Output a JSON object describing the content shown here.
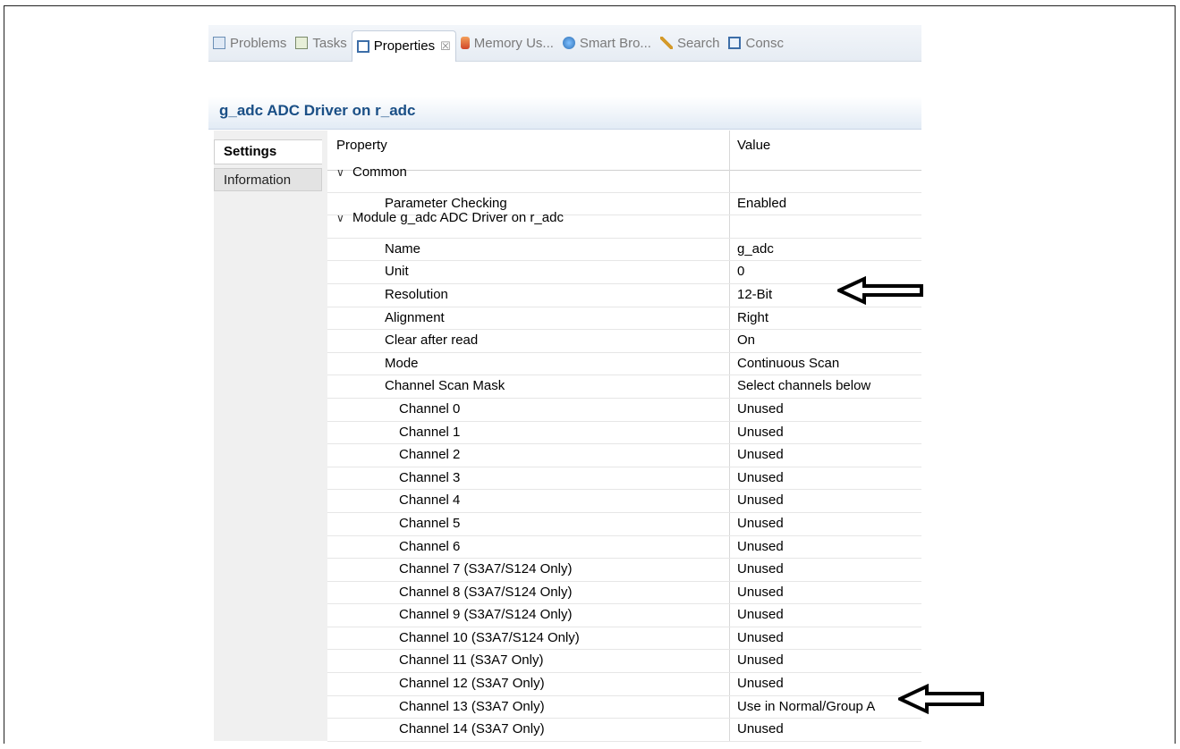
{
  "tabs": [
    {
      "label": "Problems",
      "icon": "problems-icon",
      "active": false
    },
    {
      "label": "Tasks",
      "icon": "tasks-icon",
      "active": false
    },
    {
      "label": "Properties",
      "icon": "properties-icon",
      "active": true
    },
    {
      "label": "Memory Us...",
      "icon": "memory-usage-icon",
      "active": false
    },
    {
      "label": "Smart Bro...",
      "icon": "smart-browser-icon",
      "active": false
    },
    {
      "label": "Search",
      "icon": "search-icon",
      "active": false
    },
    {
      "label": "Consc",
      "icon": "console-icon",
      "active": false
    }
  ],
  "title": "g_adc ADC Driver on r_adc",
  "side_tabs": {
    "settings": "Settings",
    "information": "Information"
  },
  "table": {
    "header_property": "Property",
    "header_value": "Value",
    "rows": [
      {
        "property": "Common",
        "value": "",
        "level": 0,
        "group": true
      },
      {
        "property": "Parameter Checking",
        "value": "Enabled",
        "level": 1
      },
      {
        "property": "Module g_adc ADC Driver on r_adc",
        "value": "",
        "level": 0,
        "group": true
      },
      {
        "property": "Name",
        "value": "g_adc",
        "level": 1
      },
      {
        "property": "Unit",
        "value": "0",
        "level": 1
      },
      {
        "property": "Resolution",
        "value": "12-Bit",
        "level": 1
      },
      {
        "property": "Alignment",
        "value": "Right",
        "level": 1
      },
      {
        "property": "Clear after read",
        "value": "On",
        "level": 1
      },
      {
        "property": "Mode",
        "value": "Continuous Scan",
        "level": 1
      },
      {
        "property": "Channel Scan Mask",
        "value": "Select channels below",
        "level": 1
      },
      {
        "property": "Channel 0",
        "value": "Unused",
        "level": 2
      },
      {
        "property": "Channel 1",
        "value": "Unused",
        "level": 2
      },
      {
        "property": "Channel 2",
        "value": "Unused",
        "level": 2
      },
      {
        "property": "Channel 3",
        "value": "Unused",
        "level": 2
      },
      {
        "property": "Channel 4",
        "value": "Unused",
        "level": 2
      },
      {
        "property": "Channel 5",
        "value": "Unused",
        "level": 2
      },
      {
        "property": "Channel 6",
        "value": "Unused",
        "level": 2
      },
      {
        "property": "Channel 7 (S3A7/S124 Only)",
        "value": "Unused",
        "level": 2
      },
      {
        "property": "Channel 8 (S3A7/S124 Only)",
        "value": "Unused",
        "level": 2
      },
      {
        "property": "Channel 9 (S3A7/S124 Only)",
        "value": "Unused",
        "level": 2
      },
      {
        "property": "Channel 10 (S3A7/S124 Only)",
        "value": "Unused",
        "level": 2
      },
      {
        "property": "Channel 11 (S3A7 Only)",
        "value": "Unused",
        "level": 2
      },
      {
        "property": "Channel 12 (S3A7 Only)",
        "value": "Unused",
        "level": 2
      },
      {
        "property": "Channel 13 (S3A7 Only)",
        "value": "Use in Normal/Group A",
        "level": 2
      },
      {
        "property": "Channel 14 (S3A7 Only)",
        "value": "Unused",
        "level": 2
      }
    ]
  }
}
